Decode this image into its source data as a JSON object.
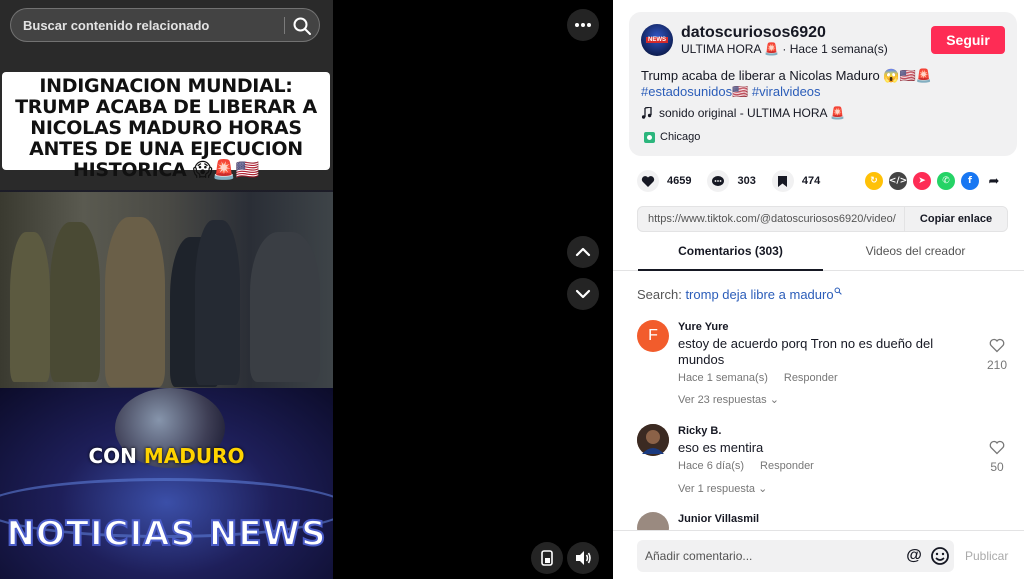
{
  "search": {
    "placeholder": "Buscar contenido relacionado"
  },
  "video": {
    "headline": "INDIGNACION MUNDIAL: TRUMP ACABA DE LIBERAR A NICOLAS MADURO HORAS ANTES DE UNA EJECUCION HISTORICA 😱🚨🇺🇸",
    "overlay_prefix": "CON",
    "overlay_name": "MADURO",
    "brand": "NOTICIAS NEWS"
  },
  "author": {
    "avatar_badge": "NEWS",
    "username": "datoscuriosos6920",
    "subline": "ULTIMA HORA 🚨 · Hace 1 semana(s)",
    "follow_label": "Seguir"
  },
  "post": {
    "caption": "Trump acaba de liberar a Nicolas Maduro 😱🇺🇸🚨",
    "hashtags": [
      "#estadosunidos🇺🇸",
      "#viralvideos"
    ],
    "sound": "sonido original - ULTIMA HORA 🚨",
    "location": "Chicago"
  },
  "stats": {
    "likes": "4659",
    "comments": "303",
    "saves": "474"
  },
  "share": [
    "repost",
    "embed",
    "send",
    "whatsapp",
    "facebook",
    "more"
  ],
  "link": {
    "url": "https://www.tiktok.com/@datoscuriosos6920/video/",
    "copy_label": "Copiar enlace"
  },
  "tabs": [
    {
      "label": "Comentarios (303)"
    },
    {
      "label": "Videos del creador"
    }
  ],
  "comment_search": {
    "label": "Search:",
    "term": "tromp deja libre a maduro"
  },
  "comments": [
    {
      "initial": "F",
      "name": "Yure Yure",
      "text": "estoy de acuerdo porq Tron no es dueño del mundos",
      "time": "Hace 1 semana(s)",
      "reply": "Responder",
      "replies": "Ver 23 respuestas ⌄",
      "likes": "210",
      "avatar_color": "#f25c2c"
    },
    {
      "initial": "",
      "name": "Ricky B.",
      "text": "eso es mentira",
      "time": "Hace 6 día(s)",
      "reply": "Responder",
      "replies": "Ver 1 respuesta ⌄",
      "likes": "50",
      "avatar_color": "#6b4a3a"
    },
    {
      "initial": "",
      "name": "Junior Villasmil",
      "text": "",
      "time": "",
      "reply": "",
      "replies": "",
      "likes": "",
      "avatar_color": "#9a8a80"
    }
  ],
  "footer": {
    "input_placeholder": "Añadir comentario...",
    "at_label": "@",
    "post_label": "Publicar"
  }
}
